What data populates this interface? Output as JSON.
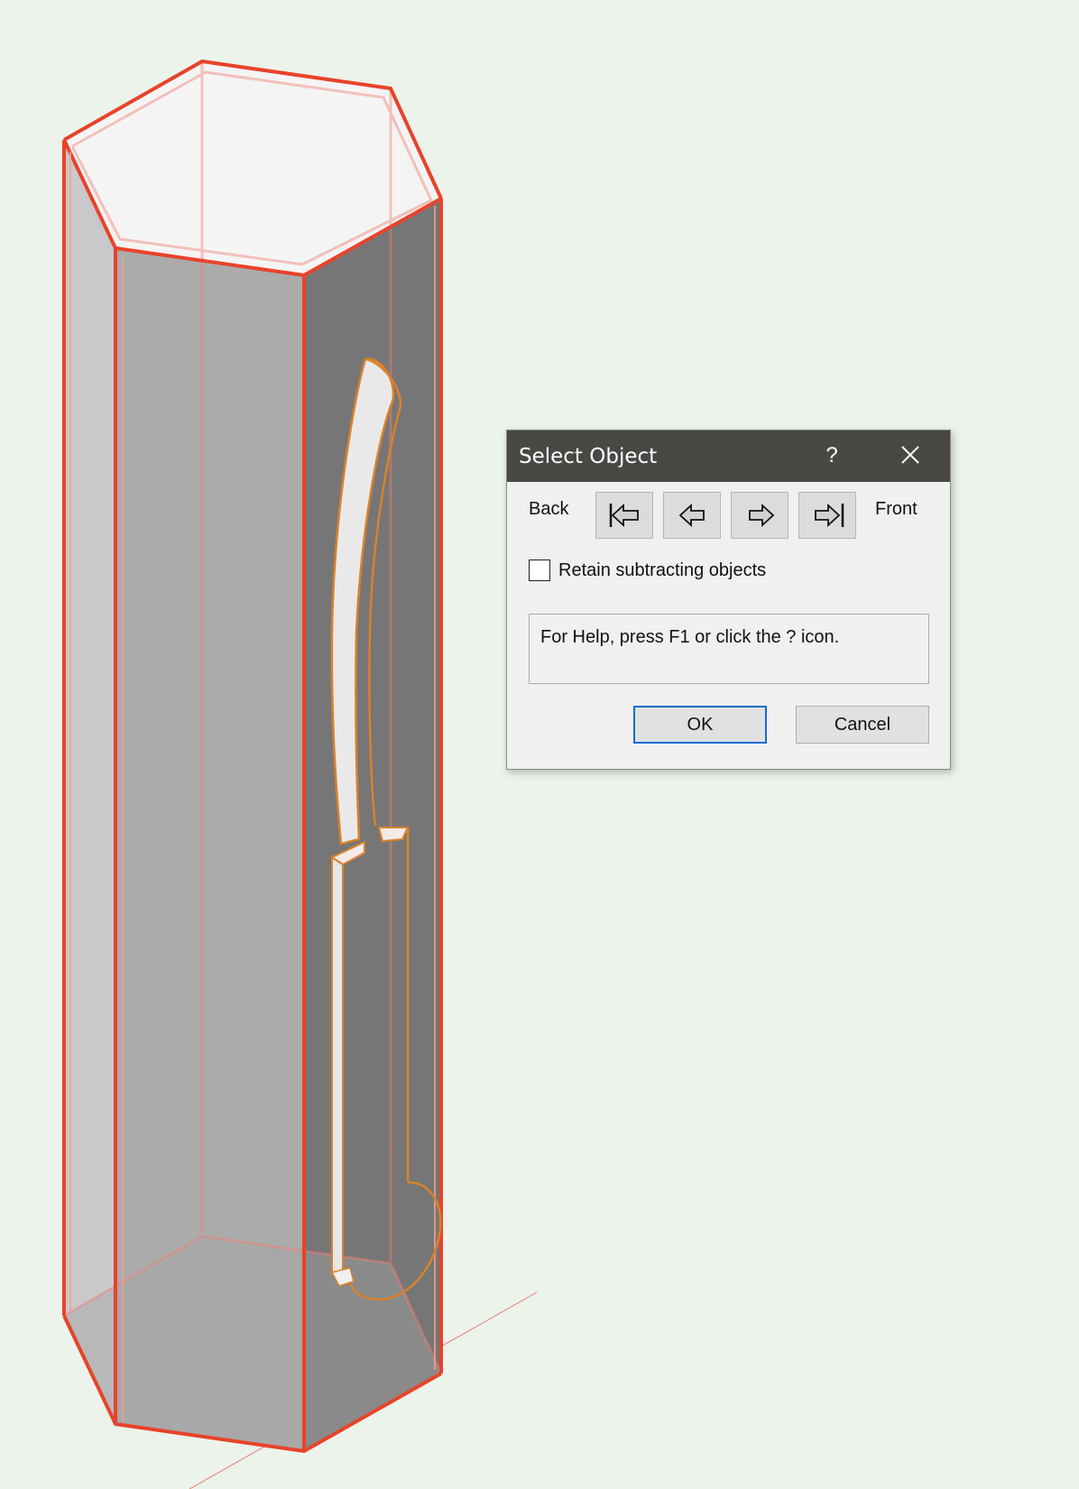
{
  "dialog": {
    "title": "Select Object",
    "help_glyph": "?",
    "close_icon": "close-icon",
    "back_label": "Back",
    "front_label": "Front",
    "nav_buttons": [
      {
        "icon": "send-to-back-icon"
      },
      {
        "icon": "send-backward-icon"
      },
      {
        "icon": "bring-forward-icon"
      },
      {
        "icon": "bring-to-front-icon"
      }
    ],
    "retain_label": "Retain subtracting objects",
    "retain_checked": false,
    "help_text": "For Help, press F1 or click the ? icon.",
    "ok_label": "OK",
    "cancel_label": "Cancel"
  },
  "colors": {
    "background": "#ebf3eb",
    "selection_highlight": "#e8432a",
    "object_outline": "#d9822b",
    "titlebar": "#4a4845",
    "default_button_border": "#0f6ed2"
  }
}
